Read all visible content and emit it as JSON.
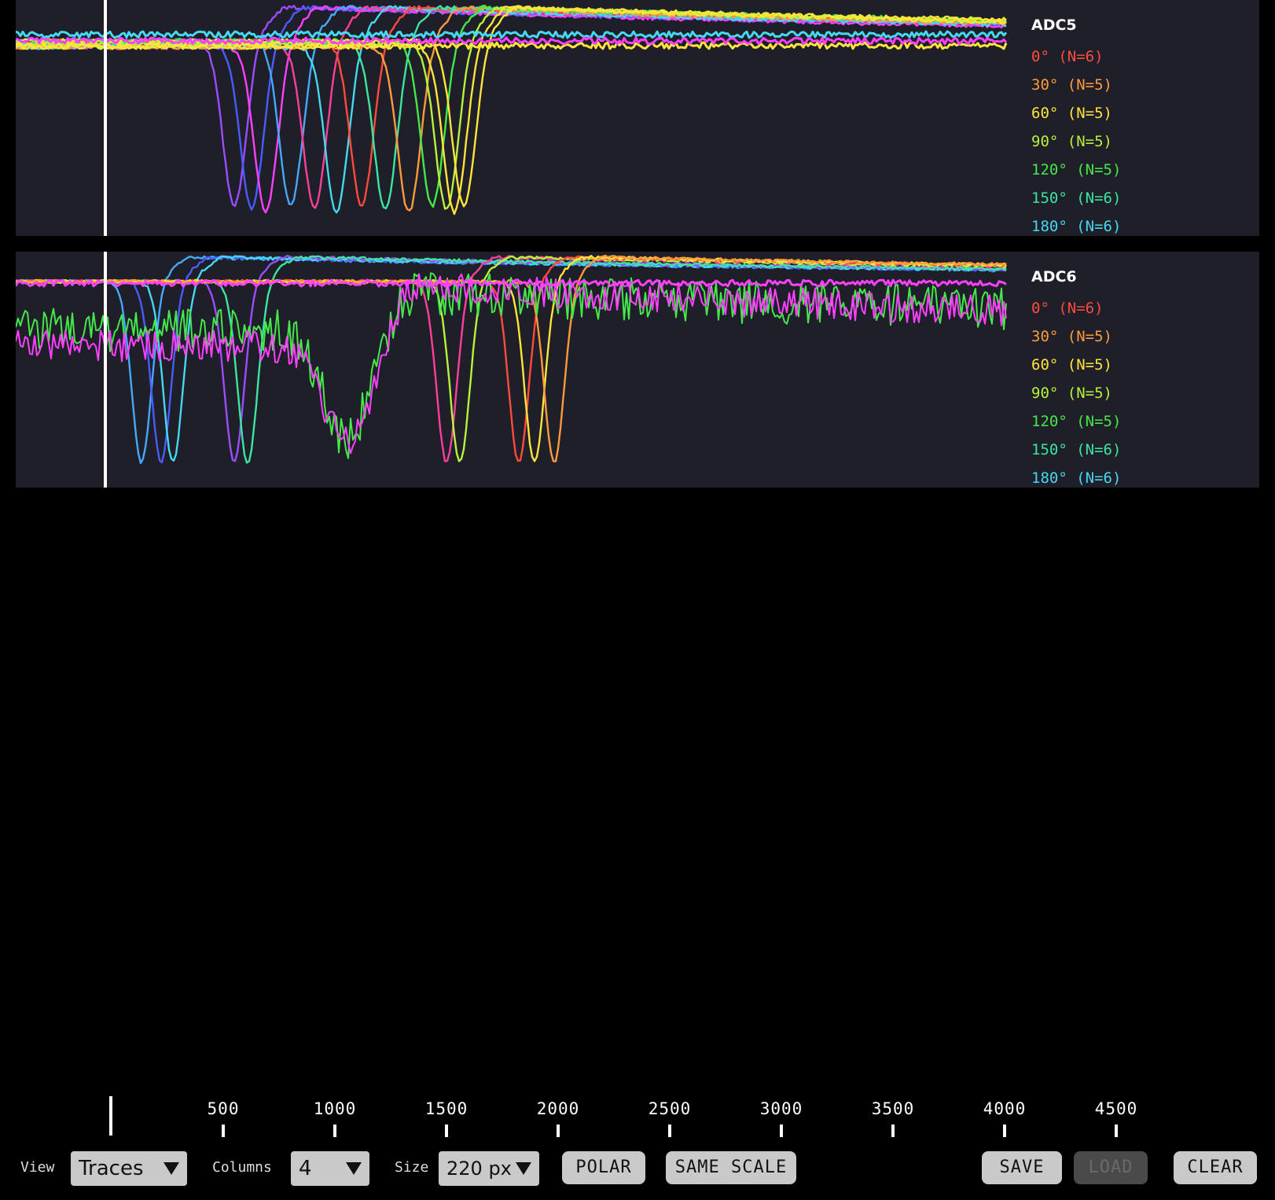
{
  "panels": [
    {
      "title": "ADC5",
      "legend": [
        {
          "label": "0° (N=6)",
          "color": "#ff4b3e"
        },
        {
          "label": "30° (N=5)",
          "color": "#ff9a3c"
        },
        {
          "label": "60° (N=5)",
          "color": "#ffe53a"
        },
        {
          "label": "90° (N=5)",
          "color": "#b8f23a"
        },
        {
          "label": "120° (N=5)",
          "color": "#45e84a"
        },
        {
          "label": "150° (N=6)",
          "color": "#3ce6a0"
        },
        {
          "label": "180° (N=6)",
          "color": "#45d8f0"
        }
      ]
    },
    {
      "title": "ADC6",
      "legend": [
        {
          "label": "0° (N=6)",
          "color": "#ff4b3e"
        },
        {
          "label": "30° (N=5)",
          "color": "#ff9a3c"
        },
        {
          "label": "60° (N=5)",
          "color": "#ffe53a"
        },
        {
          "label": "90° (N=5)",
          "color": "#b8f23a"
        },
        {
          "label": "120° (N=5)",
          "color": "#45e84a"
        },
        {
          "label": "150° (N=6)",
          "color": "#3ce6a0"
        },
        {
          "label": "180° (N=6)",
          "color": "#45d8f0"
        }
      ]
    }
  ],
  "trace_colors": {
    "purple": "#9b4dff",
    "blue": "#4a5cff",
    "magenta": "#ff40ff",
    "sky": "#47a8ff",
    "pink": "#ff3f9a"
  },
  "axis_ticks": [
    "500",
    "1000",
    "1500",
    "2000",
    "2500",
    "3000",
    "3500",
    "4000",
    "4500"
  ],
  "toolbar": {
    "view_label": "View",
    "view_value": "Traces",
    "columns_label": "Columns",
    "columns_value": "4",
    "size_label": "Size",
    "size_value": "220 px",
    "polar_label": "POLAR",
    "same_scale_label": "SAME SCALE",
    "save_label": "SAVE",
    "load_label": "LOAD",
    "clear_label": "CLEAR"
  }
}
